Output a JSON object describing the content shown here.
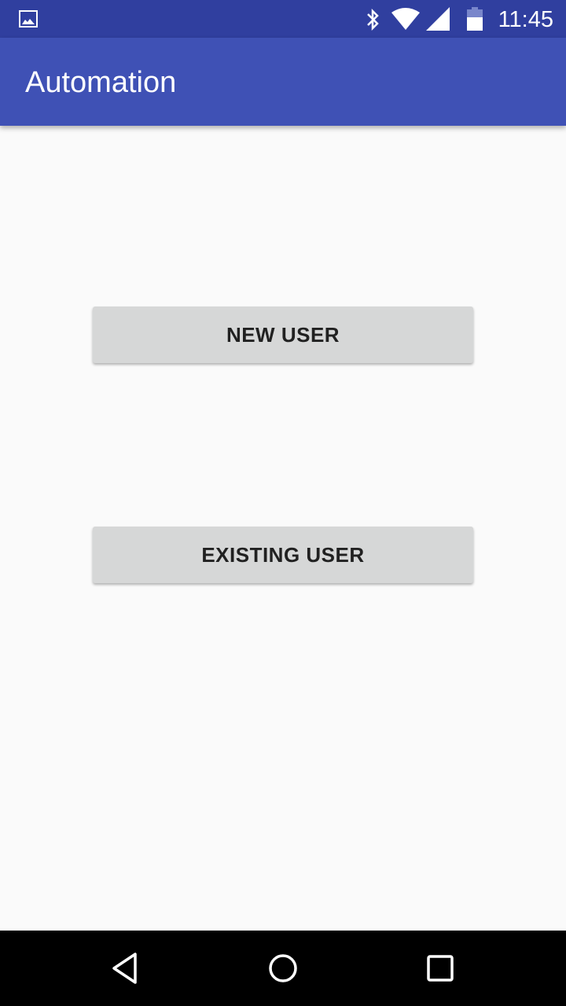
{
  "status_bar": {
    "time": "11:45",
    "icons": [
      "image-icon",
      "bluetooth-icon",
      "wifi-icon",
      "signal-icon",
      "battery-icon"
    ]
  },
  "app_bar": {
    "title": "Automation"
  },
  "buttons": {
    "new_user": "NEW USER",
    "existing_user": "EXISTING USER"
  },
  "nav_bar": {
    "icons": [
      "back-icon",
      "home-icon",
      "recents-icon"
    ]
  },
  "colors": {
    "status": "#303f9f",
    "primary": "#3f51b5",
    "button": "#d6d7d7"
  }
}
